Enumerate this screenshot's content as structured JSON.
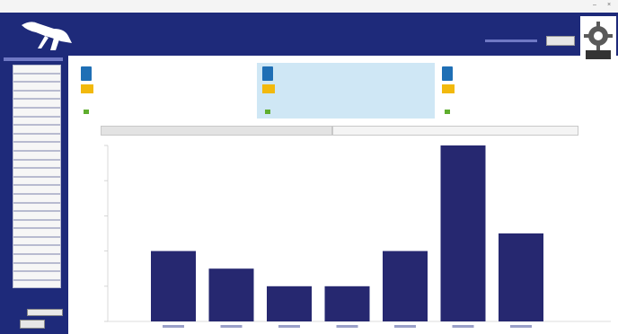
{
  "window": {
    "minimize_glyph": "–",
    "close_glyph": "×"
  },
  "header": {
    "logo_icon": "kangaroo-logo",
    "logo_text": "",
    "logo_sub": "",
    "nav": [
      "",
      ""
    ],
    "button_label": "",
    "settings_icon": "gear-icon",
    "bg_color": "#1e2a7a"
  },
  "sidebar": {
    "items": [
      "",
      "",
      "",
      "",
      "",
      "",
      "",
      "",
      "",
      "",
      "",
      "",
      "",
      "",
      "",
      "",
      "",
      "",
      "",
      "",
      "",
      "",
      "",
      "",
      "",
      ""
    ],
    "input_label": "",
    "button_label": ""
  },
  "tabs": [
    "",
    "",
    "",
    "",
    "",
    "",
    "",
    ""
  ],
  "cards": [
    {
      "title": "",
      "line1": "",
      "line2": "",
      "status": ""
    },
    {
      "title": "",
      "line1": "",
      "line2": "",
      "status": ""
    },
    {
      "title": "",
      "line1": "",
      "line2": "",
      "status": ""
    }
  ],
  "toggle": {
    "left": "",
    "right": ""
  },
  "chart_data": {
    "type": "bar",
    "categories": [
      "",
      "",
      "",
      "",
      "",
      "",
      ""
    ],
    "values": [
      4,
      3,
      2,
      2,
      4,
      10,
      5
    ],
    "ylim": [
      0,
      10
    ],
    "bar_color": "#262870",
    "grid": false
  }
}
